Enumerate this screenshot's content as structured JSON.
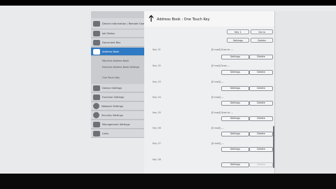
{
  "header": {
    "title": "Address Book : One Touch Key"
  },
  "top_buttons": {
    "left": "Key 1",
    "right": "Go to"
  },
  "sidebar": {
    "items": [
      {
        "label": "Device Information / Remote Operation",
        "icon": "info-icon"
      },
      {
        "label": "Job Status",
        "icon": "job-status-icon"
      },
      {
        "label": "Document Box",
        "icon": "document-box-icon"
      },
      {
        "label": "Address Book",
        "icon": "address-book-icon",
        "active": true
      },
      {
        "label": "Device Settings",
        "icon": "device-settings-icon"
      },
      {
        "label": "Function Settings",
        "icon": "function-settings-icon"
      },
      {
        "label": "Network Settings",
        "icon": "network-settings-icon"
      },
      {
        "label": "Security Settings",
        "icon": "security-settings-icon"
      },
      {
        "label": "Management Settings",
        "icon": "management-settings-icon"
      },
      {
        "label": "Links",
        "icon": "links-icon"
      }
    ],
    "subitems": [
      {
        "label": "Machine Address Book"
      },
      {
        "label": "External Address Book Settings"
      },
      {
        "label": "One Touch Key"
      }
    ]
  },
  "rows": [
    {
      "key": "Key 01",
      "name": "[E-mail] Scan to ---",
      "settings": "Settings",
      "delete": "Delete"
    },
    {
      "key": "Key 02",
      "name": "[E-mail] Scan ---",
      "settings": "Settings",
      "delete": "Delete"
    },
    {
      "key": "Key 03",
      "name": "[E-mail] ---",
      "settings": "Settings",
      "delete": "Delete"
    },
    {
      "key": "Key 04",
      "name": "[E-mail] ---",
      "settings": "Settings",
      "delete": "Delete"
    },
    {
      "key": "Key 05",
      "name": "[E-mail] Scan to ---",
      "settings": "Settings",
      "delete": "Delete"
    },
    {
      "key": "Key 06",
      "name": "[E-mail] ---",
      "settings": "Settings",
      "delete": "Delete"
    },
    {
      "key": "Key 07",
      "name": "[E-mail] ---",
      "settings": "Settings",
      "delete": "Delete"
    },
    {
      "key": "Key 08",
      "name": "",
      "settings": "Settings",
      "delete": "Delete"
    }
  ]
}
